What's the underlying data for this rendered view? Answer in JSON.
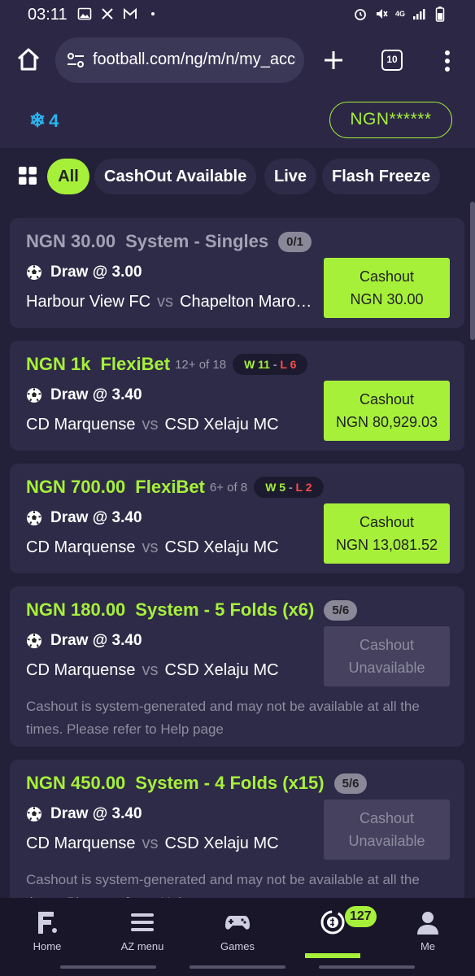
{
  "status": {
    "time": "03:11",
    "network_label": "4G"
  },
  "browser": {
    "url": "football.com/ng/m/n/my_acco",
    "tab_count": "10"
  },
  "header": {
    "freeze_count": "4",
    "balance": "NGN******"
  },
  "filters": [
    {
      "label": "All",
      "active": true
    },
    {
      "label": "CashOut Available",
      "active": false
    },
    {
      "label": "Live",
      "active": false
    },
    {
      "label": "Flash Freeze",
      "active": false
    }
  ],
  "vs_label": "vs",
  "bets": [
    {
      "stake": "NGN 30.00",
      "type": "System - Singles",
      "pill": "0/1",
      "selection": "Draw @ 3.00",
      "home": "Harbour View FC",
      "away": "Chapelton Maroons",
      "cashout_line1": "Cashout",
      "cashout_line2": "NGN 30.00"
    },
    {
      "stake": "NGN 1k",
      "type": "FlexiBet",
      "flexi_sub": "12+ of 18",
      "wins": "W 11",
      "losses": "L 6",
      "selection": "Draw @ 3.40",
      "home": "CD Marquense",
      "away": "CSD Xelaju MC",
      "cashout_line1": "Cashout",
      "cashout_line2": "NGN 80,929.03"
    },
    {
      "stake": "NGN 700.00",
      "type": "FlexiBet",
      "flexi_sub": "6+ of 8",
      "wins": "W 5",
      "losses": "L 2",
      "selection": "Draw @ 3.40",
      "home": "CD Marquense",
      "away": "CSD Xelaju MC",
      "cashout_line1": "Cashout",
      "cashout_line2": "NGN 13,081.52"
    },
    {
      "stake": "NGN 180.00",
      "type": "System - 5 Folds (x6)",
      "pill": "5/6",
      "selection": "Draw @ 3.40",
      "home": "CD Marquense",
      "away": "CSD Xelaju MC",
      "cashout_line1": "Cashout",
      "cashout_line2": "Unavailable",
      "note": "Cashout is system-generated and may not be available at all the times. Please refer to Help page"
    },
    {
      "stake": "NGN 450.00",
      "type": "System - 4 Folds (x15)",
      "pill": "5/6",
      "selection": "Draw @ 3.40",
      "home": "CD Marquense",
      "away": "CSD Xelaju MC",
      "cashout_line1": "Cashout",
      "cashout_line2": "Unavailable",
      "note": "Cashout is system-generated and may not be available at all the times. Please refer to Help page"
    }
  ],
  "nav": [
    {
      "label": "Home",
      "icon": "football-logo-icon"
    },
    {
      "label": "AZ menu",
      "icon": "menu-icon"
    },
    {
      "label": "Games",
      "icon": "gamepad-icon"
    },
    {
      "label": "",
      "icon": "betslip-icon",
      "badge": "127",
      "active": true
    },
    {
      "label": "Me",
      "icon": "user-icon"
    }
  ],
  "colors": {
    "accent": "#a6f03a",
    "background": "#232039",
    "card": "#2e2b48",
    "freeze": "#2ab4ef",
    "loss": "#ff4a4a"
  }
}
